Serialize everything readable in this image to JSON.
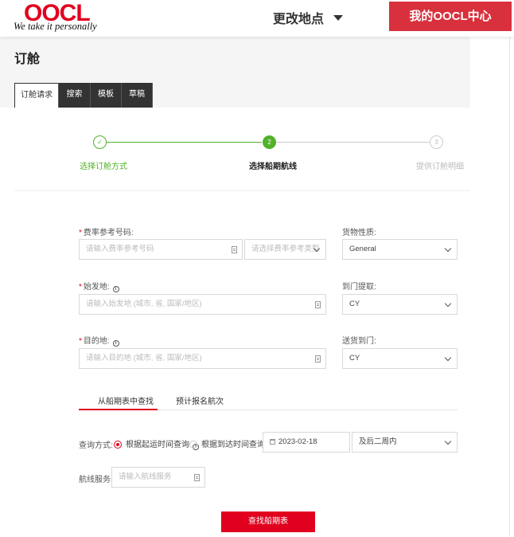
{
  "header": {
    "logo": "OOCL",
    "tagline": "We take it personally",
    "location_label": "更改地点",
    "my_center_button": "我的OOCL中心"
  },
  "page": {
    "title": "订舱",
    "tabs": [
      {
        "label": "订舱请求",
        "active": true
      },
      {
        "label": "搜索",
        "active": false
      },
      {
        "label": "模板",
        "active": false
      },
      {
        "label": "草稿",
        "active": false
      }
    ]
  },
  "steps": [
    {
      "number": "✓",
      "label": "选择订舱方式",
      "state": "done"
    },
    {
      "number": "2",
      "label": "选择船期航线",
      "state": "current"
    },
    {
      "number": "3",
      "label": "提供订舱明细",
      "state": "pending"
    }
  ],
  "form": {
    "rate_ref": {
      "label": "费率参考号码:",
      "placeholder": "请输入费率参考号码",
      "type_placeholder": "请选择费率参考类型"
    },
    "cargo_nature": {
      "label": "货物性质:",
      "value": "General"
    },
    "origin": {
      "label": "始发地:",
      "placeholder": "请输入始发地 (城市, 省, 国家/地区)"
    },
    "door_pickup": {
      "label": "到门提取:",
      "value": "CY"
    },
    "destination": {
      "label": "目的地:",
      "placeholder": "请输入目的地 (城市, 省, 国家/地区)"
    },
    "door_delivery": {
      "label": "送货到门:",
      "value": "CY"
    }
  },
  "subtabs": [
    {
      "label": "从船期表中查找",
      "active": true
    },
    {
      "label": "预计报名航次",
      "active": false
    }
  ],
  "query": {
    "method_label": "查询方式:",
    "option_departure": "根据起运时间查询",
    "option_arrival": "根据到达时间查询",
    "date": "2023-02-18",
    "range": "及后二周内",
    "service_label": "航线服务:",
    "service_placeholder": "请输入航线服务"
  },
  "search_button": "查找船期表",
  "colors": {
    "brand_red": "#e1001e",
    "green": "#52b12a"
  }
}
